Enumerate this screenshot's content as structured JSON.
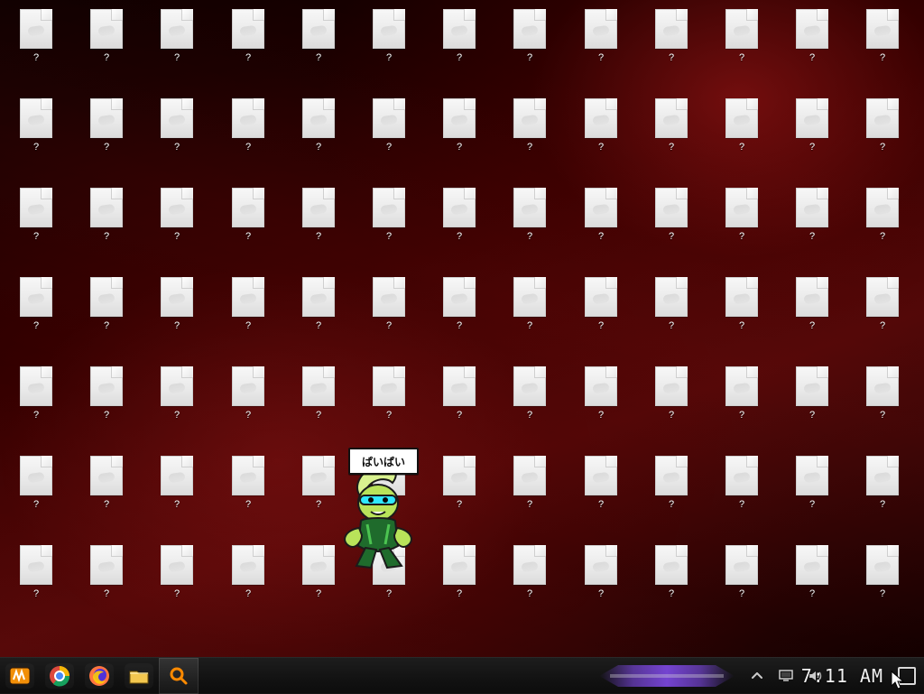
{
  "desktop": {
    "icons": [
      {
        "label": "?"
      },
      {
        "label": "?"
      },
      {
        "label": "?"
      },
      {
        "label": "?"
      },
      {
        "label": "?"
      },
      {
        "label": "?"
      },
      {
        "label": "?"
      },
      {
        "label": "?"
      },
      {
        "label": "?"
      },
      {
        "label": "?"
      },
      {
        "label": "?"
      },
      {
        "label": "?"
      },
      {
        "label": "?"
      },
      {
        "label": "?"
      },
      {
        "label": "?"
      },
      {
        "label": "?"
      },
      {
        "label": "?"
      },
      {
        "label": "?"
      },
      {
        "label": "?"
      },
      {
        "label": "?"
      },
      {
        "label": "?"
      },
      {
        "label": "?"
      },
      {
        "label": "?"
      },
      {
        "label": "?"
      },
      {
        "label": "?"
      },
      {
        "label": "?"
      },
      {
        "label": "?"
      },
      {
        "label": "?"
      },
      {
        "label": "?"
      },
      {
        "label": "?"
      },
      {
        "label": "?"
      },
      {
        "label": "?"
      },
      {
        "label": "?"
      },
      {
        "label": "?"
      },
      {
        "label": "?"
      },
      {
        "label": "?"
      },
      {
        "label": "?"
      },
      {
        "label": "?"
      },
      {
        "label": "?"
      },
      {
        "label": "?"
      },
      {
        "label": "?"
      },
      {
        "label": "?"
      },
      {
        "label": "?"
      },
      {
        "label": "?"
      },
      {
        "label": "?"
      },
      {
        "label": "?"
      },
      {
        "label": "?"
      },
      {
        "label": "?"
      },
      {
        "label": "?"
      },
      {
        "label": "?"
      },
      {
        "label": "?"
      },
      {
        "label": "?"
      },
      {
        "label": "?"
      },
      {
        "label": "?"
      },
      {
        "label": "?"
      },
      {
        "label": "?"
      },
      {
        "label": "?"
      },
      {
        "label": "?"
      },
      {
        "label": "?"
      },
      {
        "label": "?"
      },
      {
        "label": "?"
      },
      {
        "label": "?"
      },
      {
        "label": "?"
      },
      {
        "label": "?"
      },
      {
        "label": "?"
      },
      {
        "label": "?"
      },
      {
        "label": "?"
      },
      {
        "label": "?"
      },
      {
        "label": "?"
      },
      {
        "label": "?"
      },
      {
        "label": "?"
      },
      {
        "label": "?"
      },
      {
        "label": "?"
      },
      {
        "label": "?"
      },
      {
        "label": "?"
      },
      {
        "label": "?"
      },
      {
        "label": "?"
      },
      {
        "label": "?"
      },
      {
        "label": "?"
      },
      {
        "label": "?"
      },
      {
        "label": "?"
      },
      {
        "label": "?"
      },
      {
        "label": "?"
      },
      {
        "label": "?"
      },
      {
        "label": "?"
      },
      {
        "label": "?"
      },
      {
        "label": "?"
      },
      {
        "label": "?"
      },
      {
        "label": "?"
      },
      {
        "label": "?"
      },
      {
        "label": "?"
      }
    ]
  },
  "overlay": {
    "speech_text": "ぱいぱい"
  },
  "taskbar": {
    "pinned": [
      {
        "icon": "start-icon"
      },
      {
        "icon": "chrome-icon"
      },
      {
        "icon": "firefox-icon"
      },
      {
        "icon": "folder-icon"
      },
      {
        "icon": "search-icon"
      }
    ],
    "clock": "7:11 AM"
  }
}
